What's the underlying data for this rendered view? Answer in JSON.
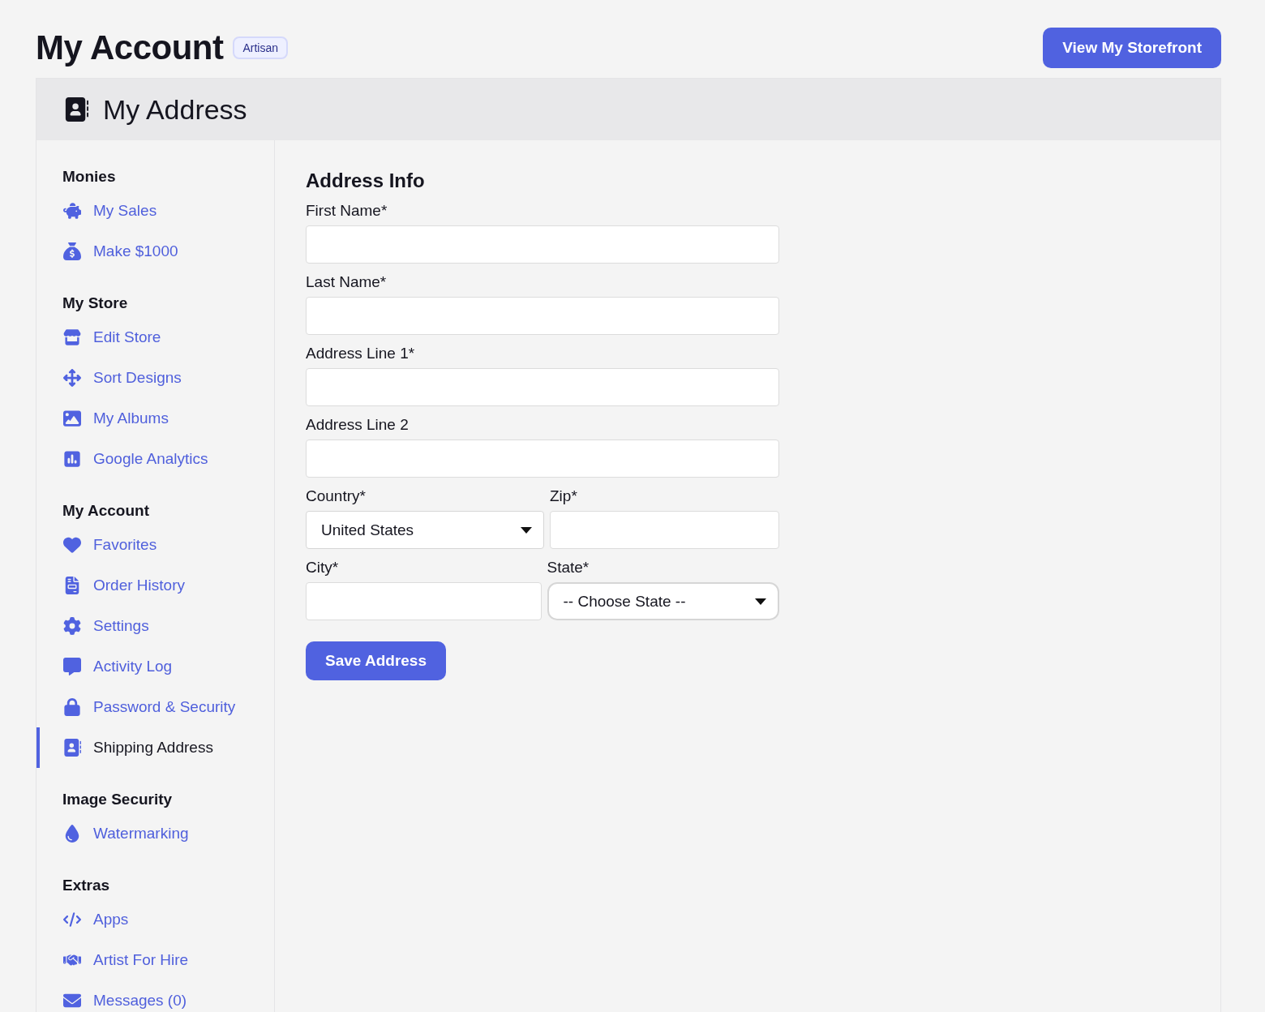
{
  "header": {
    "title": "My Account",
    "badge": "Artisan",
    "action": "View My Storefront"
  },
  "panel": {
    "title": "My Address"
  },
  "sidebar": {
    "sections": [
      {
        "title": "Monies",
        "items": [
          {
            "label": "My Sales",
            "selected": false
          },
          {
            "label": "Make $1000",
            "selected": false
          }
        ]
      },
      {
        "title": "My Store",
        "items": [
          {
            "label": "Edit Store",
            "selected": false
          },
          {
            "label": "Sort Designs",
            "selected": false
          },
          {
            "label": "My Albums",
            "selected": false
          },
          {
            "label": "Google Analytics",
            "selected": false
          }
        ]
      },
      {
        "title": "My Account",
        "items": [
          {
            "label": "Favorites",
            "selected": false
          },
          {
            "label": "Order History",
            "selected": false
          },
          {
            "label": "Settings",
            "selected": false
          },
          {
            "label": "Activity Log",
            "selected": false
          },
          {
            "label": "Password & Security",
            "selected": false
          },
          {
            "label": "Shipping Address",
            "selected": true
          }
        ]
      },
      {
        "title": "Image Security",
        "items": [
          {
            "label": "Watermarking",
            "selected": false
          }
        ]
      },
      {
        "title": "Extras",
        "items": [
          {
            "label": "Apps",
            "selected": false
          },
          {
            "label": "Artist For Hire",
            "selected": false
          },
          {
            "label": "Messages (0)",
            "selected": false
          }
        ]
      }
    ]
  },
  "form": {
    "title": "Address Info",
    "rows": [
      [
        {
          "label": "First Name*",
          "kind": "text"
        }
      ],
      [
        {
          "label": "Last Name*",
          "kind": "text"
        }
      ],
      [
        {
          "label": "Address Line 1*",
          "kind": "text"
        }
      ],
      [
        {
          "label": "Address Line 2",
          "kind": "text"
        }
      ],
      [
        {
          "label": "Country*",
          "kind": "select",
          "value": "United States"
        },
        {
          "label": "Zip*",
          "kind": "text"
        }
      ],
      [
        {
          "label": "City*",
          "kind": "text"
        },
        {
          "label": "State*",
          "kind": "select",
          "value": "-- Choose State --"
        }
      ]
    ],
    "submit": "Save Address"
  }
}
